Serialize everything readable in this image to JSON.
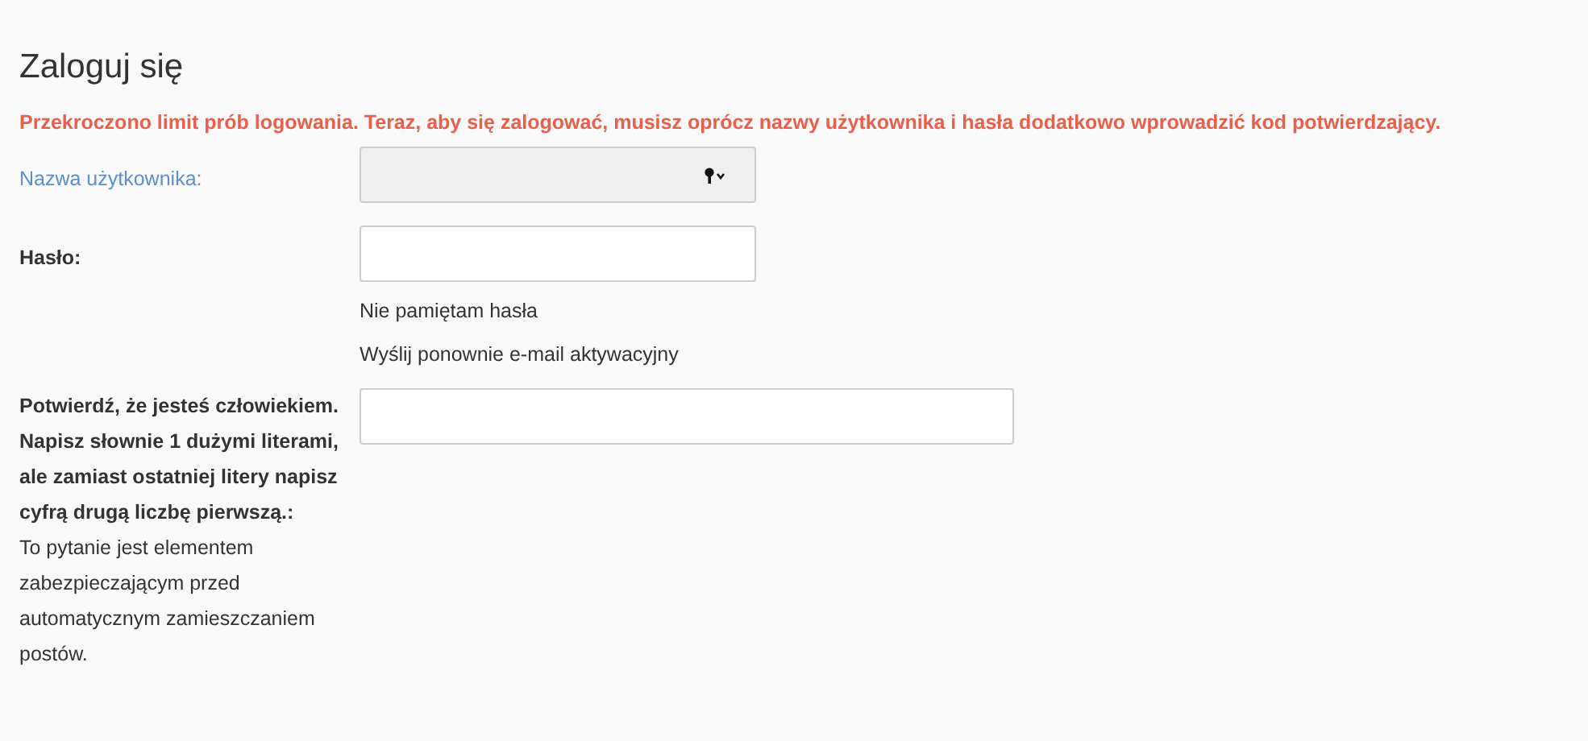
{
  "title": "Zaloguj się",
  "error": "Przekroczono limit prób logowania. Teraz, aby się zalogować, musisz oprócz nazwy użytkownika i hasła dodatkowo wprowadzić kod potwierdzający.",
  "fields": [
    {
      "kind": "username",
      "label": "Nazwa użytkownika:",
      "focused": true
    },
    {
      "kind": "password",
      "label": "Hasło:",
      "focused": false,
      "links": [
        "Nie pamiętam hasła",
        "Wyślij ponownie e-mail aktywacyjny"
      ]
    },
    {
      "kind": "captcha",
      "label": "Potwierdź, że jesteś człowiekiem. Napisz słownie 1 dużymi literami, ale zamiast ostatniej litery napisz cyfrą drugą liczbę pierwszą.:",
      "hint": "To pytanie jest elementem zabezpieczającym przed automatycznym zamieszczaniem postów.",
      "focused": false
    }
  ]
}
